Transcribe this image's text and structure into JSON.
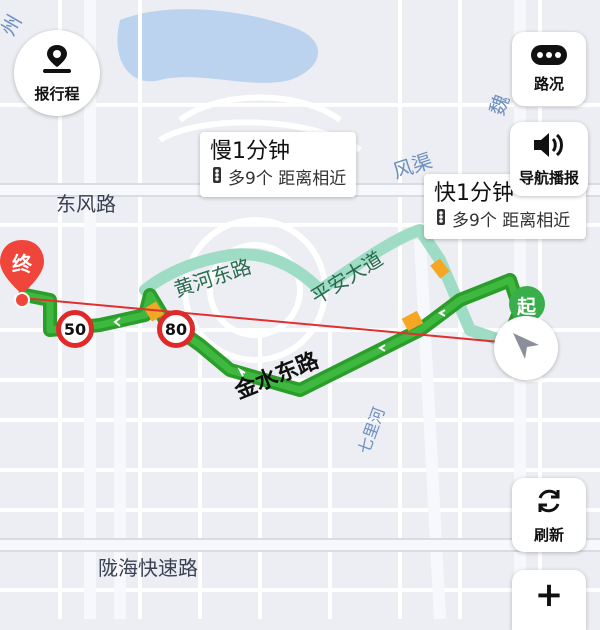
{
  "map": {
    "road_labels": {
      "dongfeng": "东风路",
      "huanghe": "黄河东路",
      "pingan": "平安大道",
      "jinshui": "金水东路",
      "longhai": "陇海快速路",
      "fengqu": "风渠",
      "zhou": "州",
      "wei": "魏",
      "qihe": "七里河"
    },
    "markers": {
      "end": "终",
      "start": "起"
    }
  },
  "controls": {
    "report_trip": "报行程",
    "traffic": "路况",
    "nav_broadcast": "导航播报",
    "refresh": "刷新",
    "zoom_in": "+"
  },
  "route_bubbles": {
    "slow": {
      "title": "慢1分钟",
      "detail": "多9个 距离相近"
    },
    "fast": {
      "title": "快1分钟",
      "detail": "多9个 距离相近"
    }
  },
  "speed_limits": [
    "50",
    "80"
  ],
  "colors": {
    "route": "#2a9d2a",
    "alt_route": "#9fdcc5",
    "congestion": "#f5a623",
    "end_marker": "#f0453a",
    "start_marker": "#3aae4a",
    "speed_ring": "#e02a2a"
  }
}
